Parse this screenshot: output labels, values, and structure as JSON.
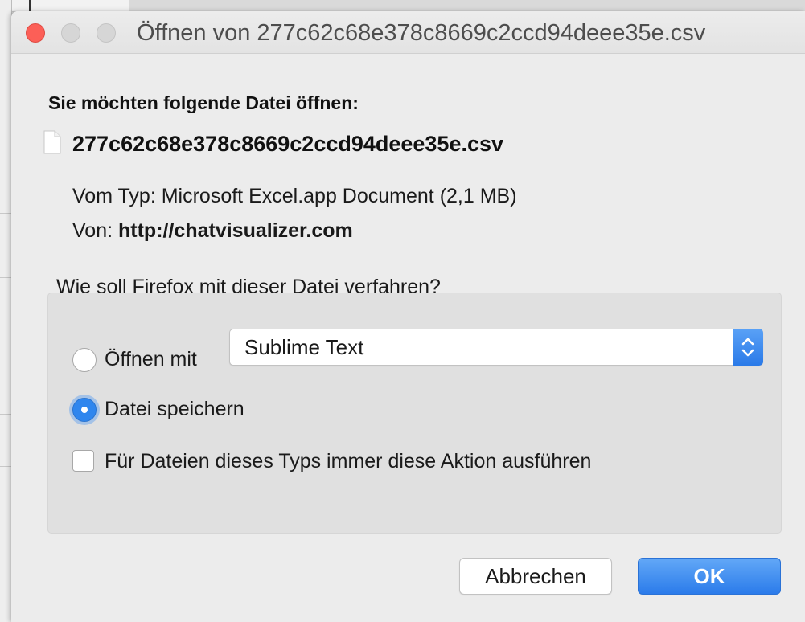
{
  "window": {
    "title": "Öffnen von 277c62c68e378c8669c2ccd94deee35e.csv"
  },
  "dialog": {
    "heading": "Sie möchten folgende Datei öffnen:",
    "file_name": "277c62c68e378c8669c2ccd94deee35e.csv",
    "type_label": "Vom Typ:",
    "type_value": "Microsoft Excel.app Document (2,1 MB)",
    "from_label": "Von:",
    "from_value": "http://chatvisualizer.com",
    "question": "Wie soll Firefox mit dieser Datei verfahren?"
  },
  "options": {
    "open_with_label": "Öffnen mit",
    "open_with_selected": false,
    "application": "Sublime Text",
    "save_label": "Datei speichern",
    "save_selected": true,
    "always_label": "Für Dateien dieses Typs immer diese Aktion ausführen",
    "always_checked": false
  },
  "buttons": {
    "cancel": "Abbrechen",
    "ok": "OK"
  },
  "colors": {
    "accent": "#2f86ee",
    "close": "#fc5f57",
    "dialog_bg": "#ececec"
  }
}
